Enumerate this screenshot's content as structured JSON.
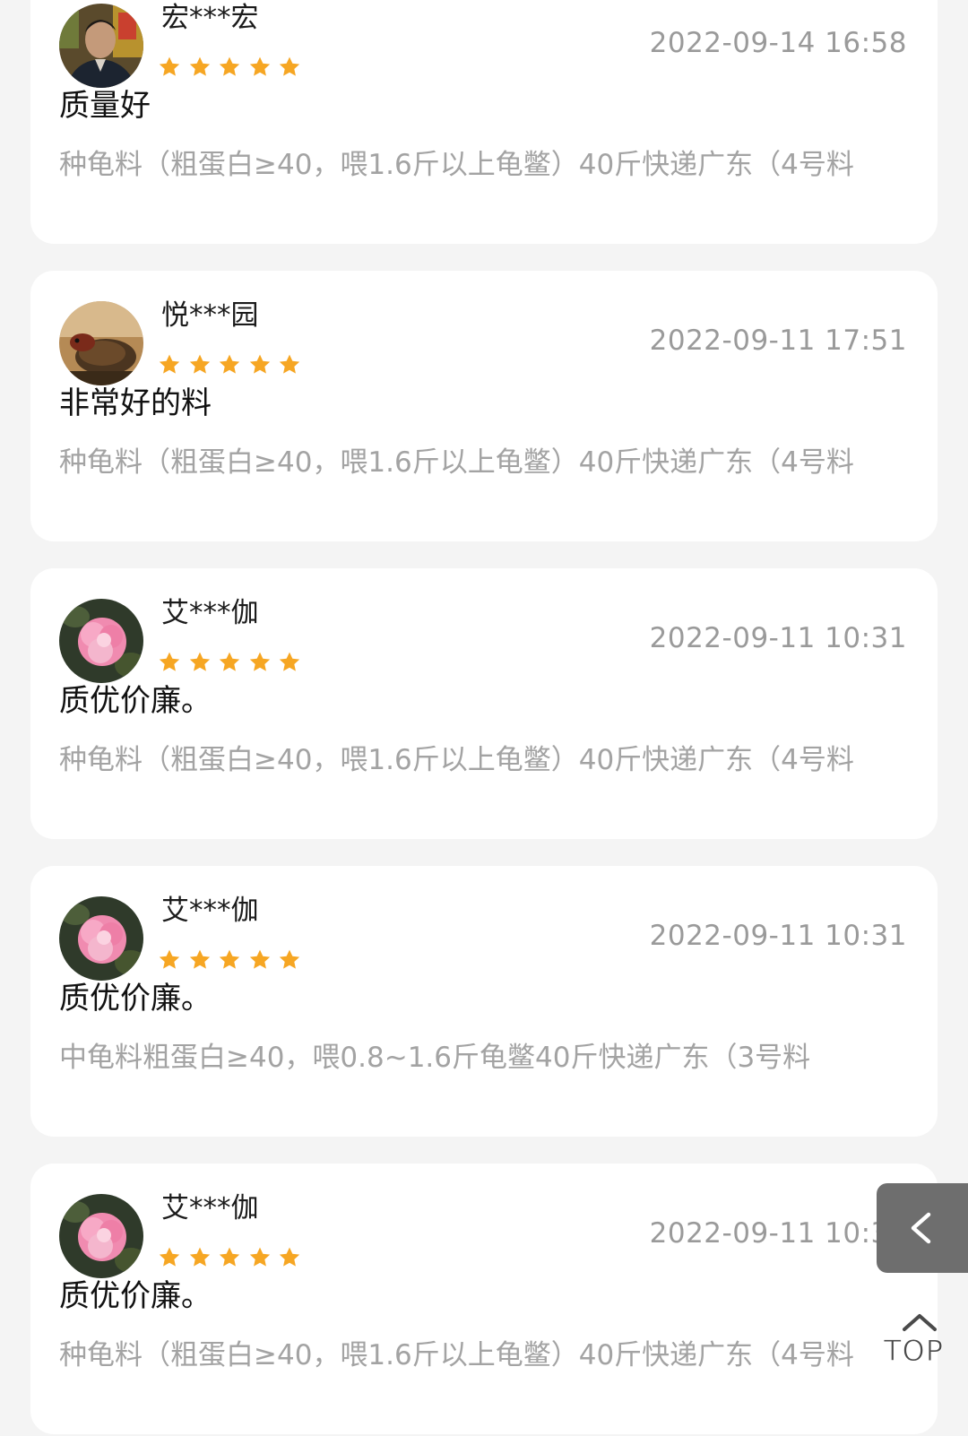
{
  "colors": {
    "star": "#f6a623",
    "card_background": "#ffffff",
    "page_background": "#f4f4f4",
    "timestamp": "#9a9a9a",
    "spec_text": "#a3a3a3"
  },
  "reviews": [
    {
      "username": "宏***宏",
      "avatar": "man-portrait",
      "rating": 5,
      "timestamp": "2022-09-14 16:58",
      "comment": "质量好",
      "product_spec": "种龟料（粗蛋白≥40，喂1.6斤以上龟鳖）40斤快递广东（4号料"
    },
    {
      "username": "悦***园",
      "avatar": "turtle-photo",
      "rating": 5,
      "timestamp": "2022-09-11 17:51",
      "comment": "非常好的料",
      "product_spec": "种龟料（粗蛋白≥40，喂1.6斤以上龟鳖）40斤快递广东（4号料"
    },
    {
      "username": "艾***伽",
      "avatar": "pink-flower",
      "rating": 5,
      "timestamp": "2022-09-11 10:31",
      "comment": "质优价廉。",
      "product_spec": "种龟料（粗蛋白≥40，喂1.6斤以上龟鳖）40斤快递广东（4号料"
    },
    {
      "username": "艾***伽",
      "avatar": "pink-flower",
      "rating": 5,
      "timestamp": "2022-09-11 10:31",
      "comment": "质优价廉。",
      "product_spec": "中龟料粗蛋白≥40，喂0.8~1.6斤龟鳖40斤快递广东（3号料"
    },
    {
      "username": "艾***伽",
      "avatar": "pink-flower",
      "rating": 5,
      "timestamp": "2022-09-11 10:31",
      "comment": "质优价廉。",
      "product_spec": "种龟料（粗蛋白≥40，喂1.6斤以上龟鳖）40斤快递广东（4号料"
    }
  ],
  "floating": {
    "back_icon": "chevron-left-icon",
    "top_icon": "chevron-up-icon",
    "top_label": "TOP"
  }
}
